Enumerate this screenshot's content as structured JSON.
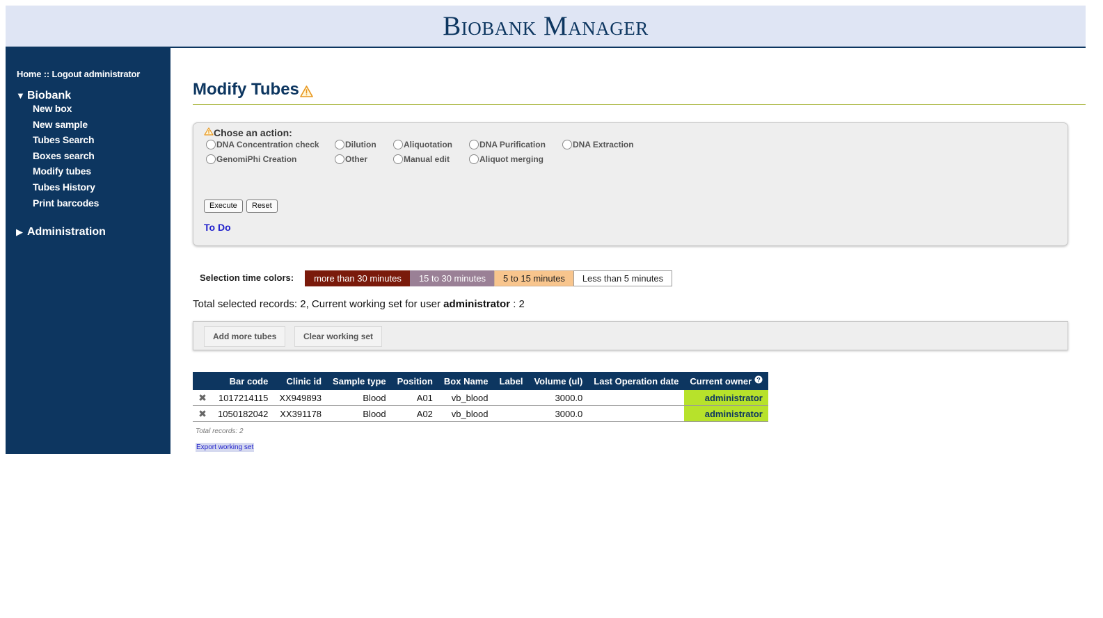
{
  "header": {
    "title": "Biobank Manager"
  },
  "sidebar": {
    "home_link": "Home",
    "separator": "::",
    "logout_link": "Logout administrator",
    "sections": [
      {
        "label": "Biobank",
        "expanded": true,
        "items": [
          "New box",
          "New sample",
          "Tubes Search",
          "Boxes search",
          "Modify tubes",
          "Tubes History",
          "Print barcodes"
        ]
      },
      {
        "label": "Administration",
        "expanded": false,
        "items": []
      }
    ]
  },
  "main": {
    "title": "Modify Tubes",
    "action_panel": {
      "heading": "Chose an action:",
      "options": [
        "DNA Concentration check",
        "Dilution",
        "Aliquotation",
        "DNA Purification",
        "DNA Extraction",
        "GenomiPhi Creation",
        "Other",
        "Manual edit",
        "Aliquot merging"
      ],
      "execute_label": "Execute",
      "reset_label": "Reset",
      "todo_label": "To Do"
    },
    "legend": {
      "label": "Selection time colors:",
      "items": [
        {
          "text": "more than 30 minutes",
          "bg": "#7a1a0b",
          "fg": "#ffffff"
        },
        {
          "text": "15 to 30 minutes",
          "bg": "#9a8096",
          "fg": "#ffffff"
        },
        {
          "text": "5 to 15 minutes",
          "bg": "#f8c58d",
          "fg": "#222222"
        },
        {
          "text": "Less than 5 minutes",
          "bg": "#ffffff",
          "fg": "#222222"
        }
      ]
    },
    "summary": {
      "prefix": "Total selected records: 2, Current working set for user",
      "user": "administrator",
      "suffix": ": 2"
    },
    "tools": {
      "add_label": "Add more tubes",
      "clear_label": "Clear working set"
    },
    "table": {
      "columns": [
        "Bar code",
        "Clinic id",
        "Sample type",
        "Position",
        "Box Name",
        "Label",
        "Volume (ul)",
        "Last Operation date",
        "Current owner"
      ],
      "rows": [
        {
          "barcode": "1017214115",
          "clinic": "XX949893",
          "type": "Blood",
          "position": "A01",
          "box": "vb_blood",
          "label": "",
          "volume": "3000.0",
          "last_op": "",
          "owner": "administrator"
        },
        {
          "barcode": "1050182042",
          "clinic": "XX391178",
          "type": "Blood",
          "position": "A02",
          "box": "vb_blood",
          "label": "",
          "volume": "3000.0",
          "last_op": "",
          "owner": "administrator"
        }
      ],
      "total_records": "Total records: 2",
      "export_label": "Export working set"
    }
  },
  "colors": {
    "navy": "#0d3660",
    "header_bg": "#dfe5f4",
    "owner_green": "#b7e22b",
    "link_blue": "#2222cc"
  },
  "icons": {
    "warning": "warning-icon",
    "delete": "delete-x-icon",
    "help": "help-icon"
  }
}
